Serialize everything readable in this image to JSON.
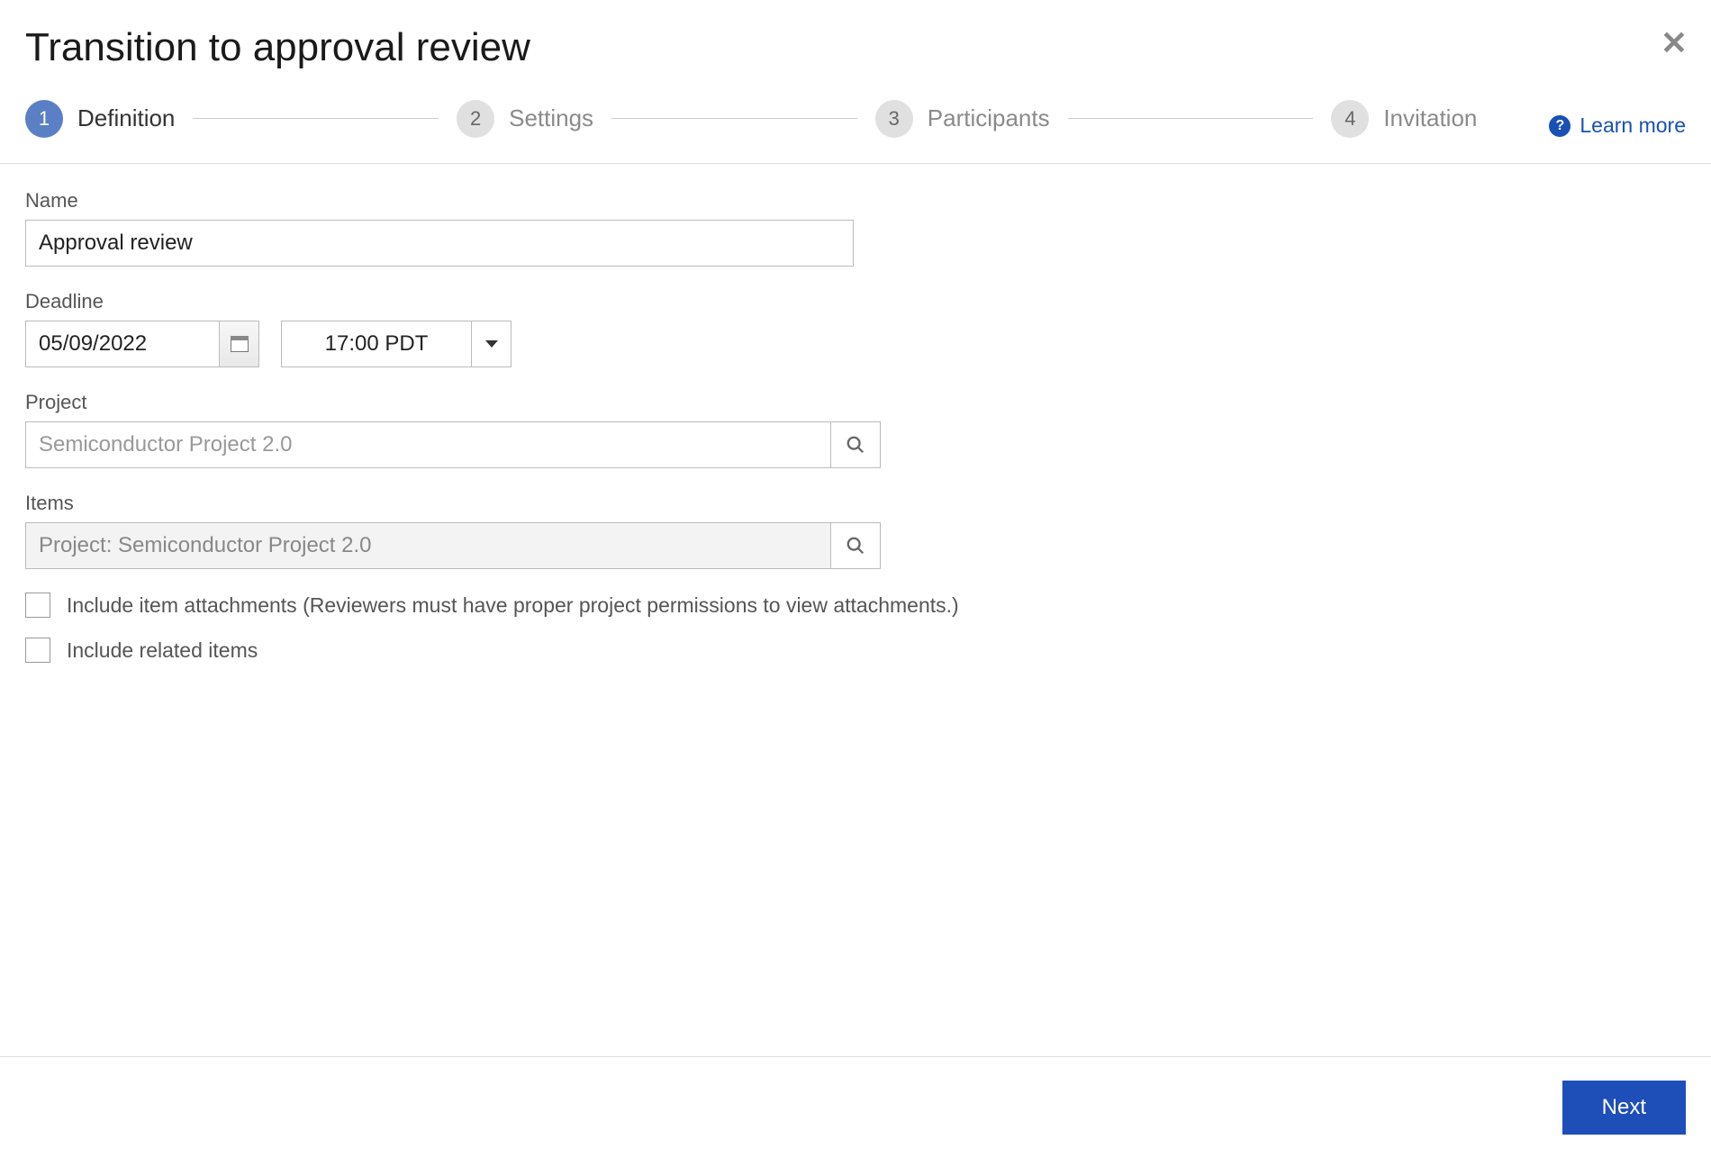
{
  "header": {
    "title": "Transition to approval review"
  },
  "stepper": {
    "steps": [
      {
        "num": "1",
        "label": "Definition"
      },
      {
        "num": "2",
        "label": "Settings"
      },
      {
        "num": "3",
        "label": "Participants"
      },
      {
        "num": "4",
        "label": "Invitation"
      }
    ],
    "learn_more": "Learn more"
  },
  "form": {
    "name_label": "Name",
    "name_value": "Approval review",
    "deadline_label": "Deadline",
    "deadline_date": "05/09/2022",
    "deadline_time": "17:00 PDT",
    "project_label": "Project",
    "project_value": "Semiconductor Project 2.0",
    "items_label": "Items",
    "items_value": "Project: Semiconductor Project 2.0",
    "include_attachments_label": "Include item attachments (Reviewers must have proper project permissions to view attachments.)",
    "include_related_label": "Include related items"
  },
  "footer": {
    "next_label": "Next"
  }
}
